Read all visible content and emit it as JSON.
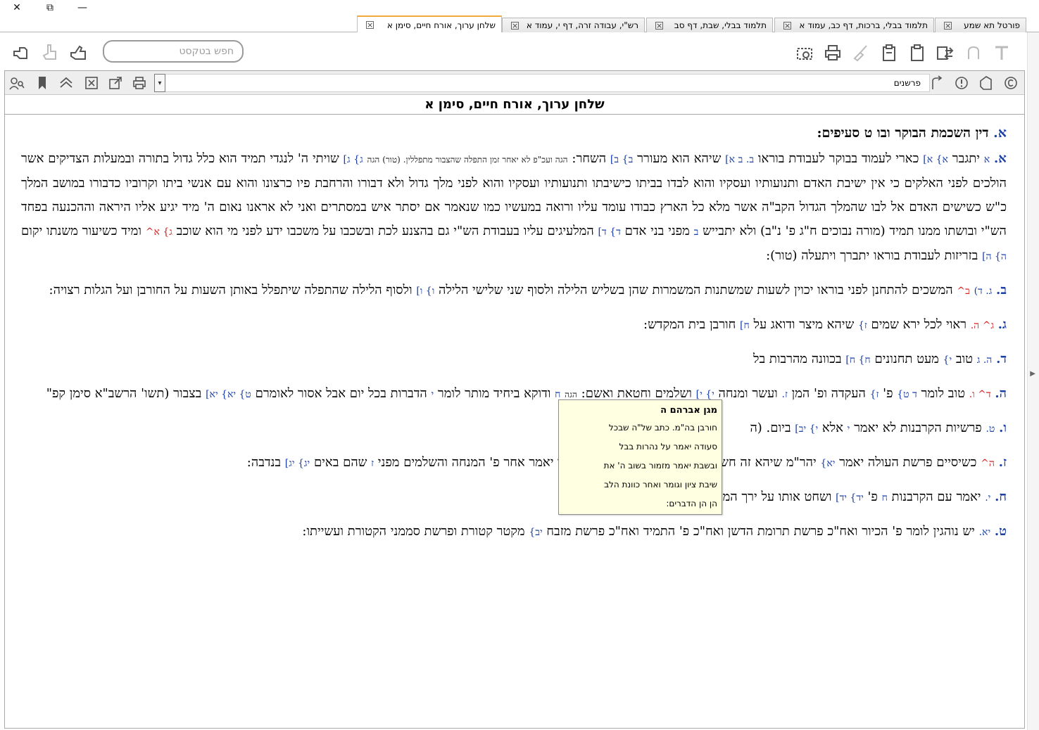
{
  "window": {
    "close_glyph": "✕",
    "restore_glyph": "⧉",
    "minimize_glyph": "—"
  },
  "tabs": [
    {
      "label": "פורטל תא שמע",
      "active": false
    },
    {
      "label": "תלמוד בבלי, ברכות, דף כב, עמוד א",
      "active": false
    },
    {
      "label": "תלמוד בבלי, שבת, דף סב",
      "active": false
    },
    {
      "label": "רש\"י, עבודה זרה, דף י, עמוד א",
      "active": false
    },
    {
      "label": "שלחן ערוך, אורח חיים, סימן א",
      "active": true
    }
  ],
  "tab_close_glyph": "×",
  "toolbar": {
    "search_placeholder": "חפש בטקסט"
  },
  "subbar": {
    "commentators_label": "פרשנים",
    "dropdown_glyph": "▾"
  },
  "document": {
    "title": "שלחן ערוך, אורח חיים, סימן א",
    "heading_letter": "א.",
    "heading_text": "דין השכמת הבוקר ובו ט סעיפים:",
    "p1": {
      "seif": "א.",
      "r1": "א",
      "t1": "יתגבר",
      "r2": "א} א]",
      "t2": "כארי לעמוד בבוקר לעבודת בוראו",
      "r3": "ב. ב א]",
      "t3": "שיהא הוא מעורר",
      "r4": "ב} ב]",
      "t4": "השחר:",
      "hagah1": "הגה ועכ\"פ לא יאחר זמן התפלה שהצבור מתפללין. (טור) הגה",
      "r5": "ג} ג]",
      "t5": "שויתי ה' לנגדי תמיד הוא כלל גדול בתורה ובמעלות הצדיקים אשר הולכים לפני האלקים כי אין ישיבת האדם ותנועותיו ועסקיו והוא לבדו בביתו כישיבתו ותנועותיו ועסקיו והוא לפני מלך גדול ולא דבורו והרחבת פיו כרצונו והוא עם אנשי ביתו וקרוביו כדבורו במושב המלך כ\"ש כשישים האדם אל לבו שהמלך הגדול הקב\"ה אשר מלא כל הארץ כבודו עומד עליו ורואה במעשיו כמו שנאמר אם יסתר איש במסתרים ואני לא אראנו נאום ה' מיד יגיע אליו היראה וההכנעה בפחד הש\"י ובושתו ממנו תמיד (מורה נבוכים ח\"ג פ' נ\"ב) ולא יתבייש",
      "r6": "ב",
      "t6": "מפני בני אדם",
      "r7": "ד} ד]",
      "t7": "המלעיגים עליו בעבודת הש\"י גם בהצנע לכת ובשכבו על משכבו ידע לפני מי הוא שוכב",
      "r8": "ג} א^",
      "t8": "ומיד כשיעור משנתו יקום",
      "r9": "ה} ה]",
      "t9": "בזריזות לעבודת בוראו יתברך ויתעלה (טור):"
    },
    "p2": {
      "seif": "ב.",
      "r1": "ג. ד)",
      "r2": "ב^",
      "t1": "המשכים להתחנן לפני בוראו יכוין לשעות שמשתנות המשמרות שהן בשליש הלילה ולסוף שני שלישי הלילה",
      "r3": "ו} ו]",
      "t2": "ולסוף הלילה שהתפלה שיתפלל באותן השעות על החורבן ועל הגלות רצויה:"
    },
    "p3": {
      "seif": "ג.",
      "r1": "ג^ ה.",
      "t1": "ראוי לכל ירא שמים",
      "r2": "ז}",
      "t2": "שיהא מיצר ודואג על",
      "r3": "ח]",
      "t3": "חורבן בית המקדש:"
    },
    "p4": {
      "seif": "ד.",
      "r1": "ה. ג",
      "t1": "טוב",
      "r2": "י}",
      "t2": "מעט תחנונים",
      "r3": "ח} ח]",
      "t3": "בכוונה מהרבות בל"
    },
    "p5": {
      "seif": "ה.",
      "r1": "ד^ ו.",
      "t1": "טוב לומר",
      "r2": "ד ט}",
      "t2": "פ'",
      "r3": "ז}",
      "t3": "העקדה ופ' המן",
      "r4": "ז.",
      "t4": "ועשר",
      "t5": "ומנחה",
      "r5": "י} י]",
      "t6": "ושלמים וחטאת ואשם:",
      "hagah": "הגה",
      "r6": "ח",
      "t7": "ודוקא ביחיד מותר לומר",
      "r7": "י",
      "t8": "הדברות בכל יום אבל אסור לאומרם",
      "r8": "ט} יא} יא]",
      "t9": "בצבור (תשו' הרשב\"א סימן קפ\""
    },
    "p6": {
      "seif": "ו.",
      "r1": "ט.",
      "t1": "פרשיות הקרבנות לא יאמר",
      "r2": "י",
      "t2": "אלא",
      "r3": "י} יב]",
      "t3": "ביום. (ה"
    },
    "p7": {
      "seif": "ז.",
      "r1": "ה^",
      "t1": "כשיסיים פרשת העולה יאמר",
      "r2": "יא}",
      "t2": "יהר\"מ שיהא זה חשוב ומקובל כאלו הקרבתי עולה וכך יאמר אחר פ' המנחה והשלמים מפני",
      "r3": "ז",
      "t3": "שהם באים",
      "r4": "יג} יג]",
      "t4": "בנדבה:"
    },
    "p8": {
      "seif": "ח.",
      "r1": "י.",
      "t1": "יאמר עם הקרבנות",
      "r2": "ח",
      "t2": "פ'",
      "r3": "יד} יד]",
      "t3": "ושחט אותו על ירך המזבח צפונה לפני ה':"
    },
    "p9": {
      "seif": "ט.",
      "r1": "יא.",
      "t1": "יש נוהגין לומר פ' הכיור ואח\"כ פרשת תרומת הדשן ואח\"כ פ' התמיד ואח\"כ פרשת מזבח",
      "r2": "יב}",
      "t2": "מקטר קטורת ופרשת סממני הקטורת ועשייתו:"
    }
  },
  "tooltip": {
    "title": "מגן אברהם ה",
    "lines": [
      "חורבן בה\"מ. כתב של\"ה שבכל",
      "סעודה יאמר על נהרות בבל",
      "ובשבת יאמר מזמור בשוב ה' את",
      "שיבת ציון וגומר ואחר כוונת הלב",
      "הן הן הדברים:"
    ]
  }
}
